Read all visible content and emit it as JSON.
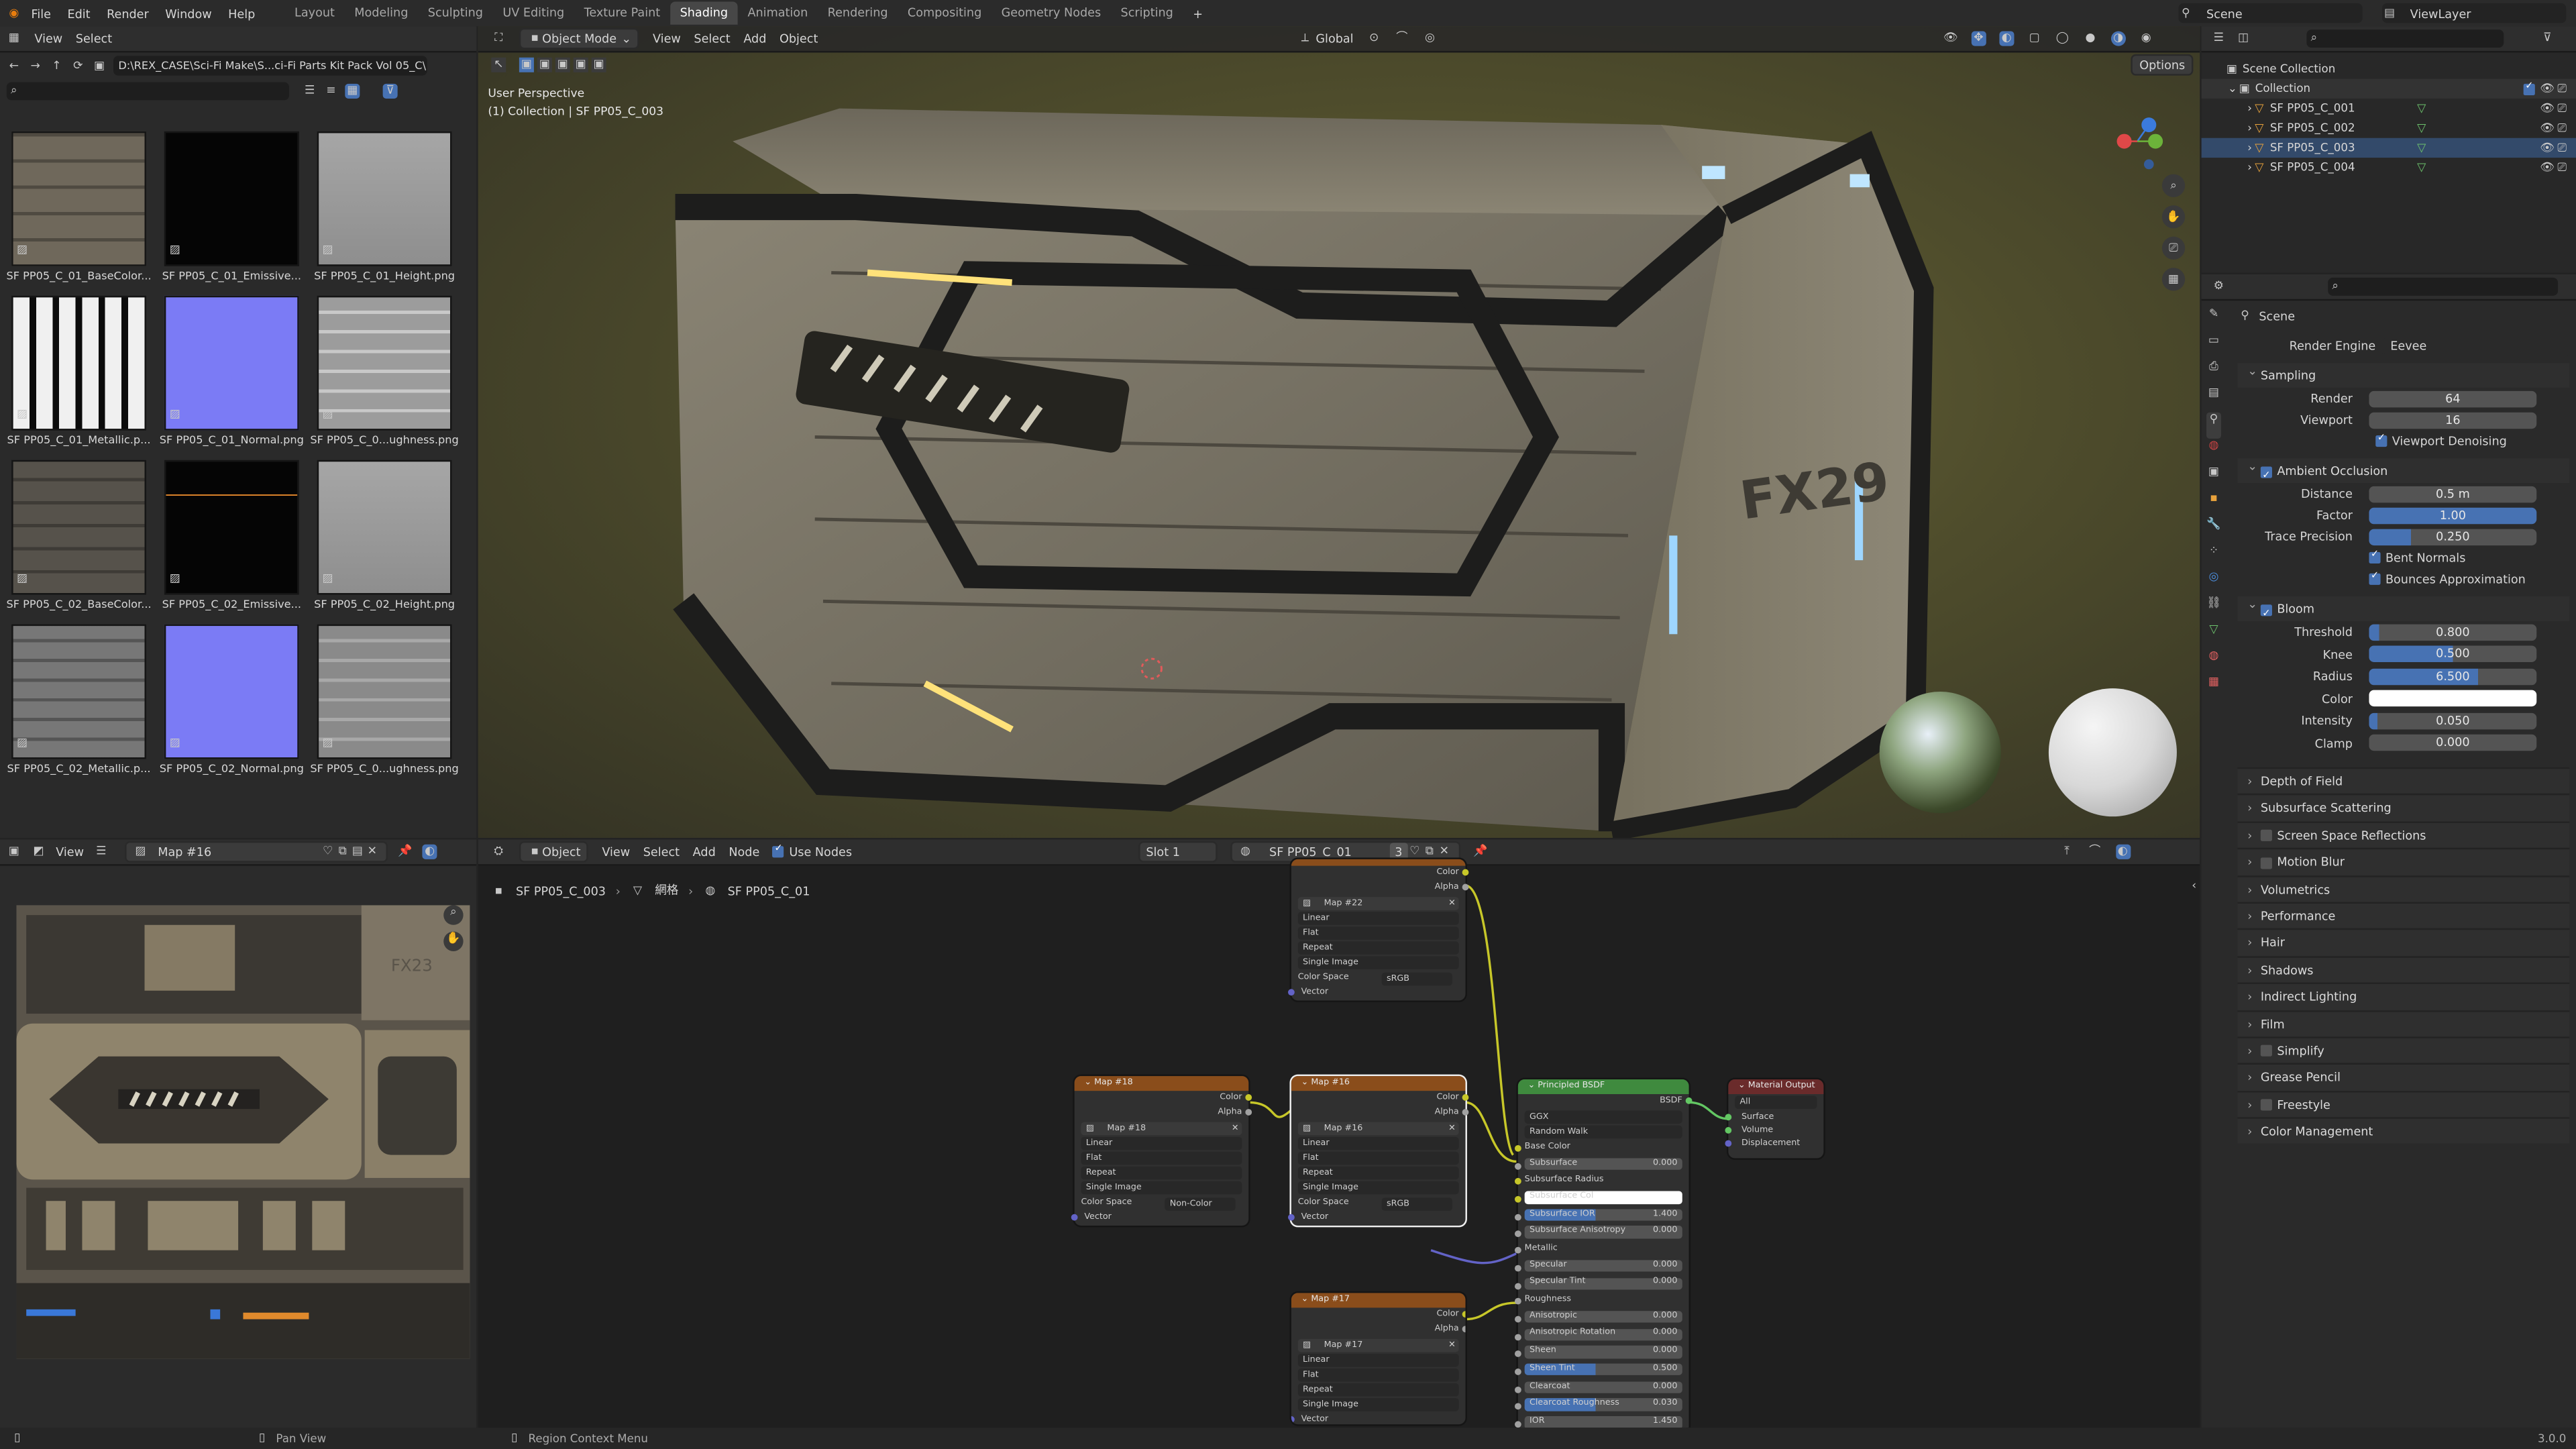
{
  "topbar": {
    "menus": [
      "File",
      "Edit",
      "Render",
      "Window",
      "Help"
    ],
    "workspaces": [
      "Layout",
      "Modeling",
      "Sculpting",
      "UV Editing",
      "Texture Paint",
      "Shading",
      "Animation",
      "Rendering",
      "Compositing",
      "Geometry Nodes",
      "Scripting"
    ],
    "active_workspace": "Shading",
    "scene": "Scene",
    "view_layer": "ViewLayer"
  },
  "file_browser": {
    "menus": [
      "View",
      "Select"
    ],
    "path": "D:\\REX_CASE\\Sci-Fi Make\\S...ci-Fi Parts Kit Pack Vol 05_C\\",
    "thumbnails": [
      {
        "label": "SF PP05_C_01_BaseColor...",
        "kind": "basecolor"
      },
      {
        "label": "SF PP05_C_01_Emissive...",
        "kind": "emissive"
      },
      {
        "label": "SF PP05_C_01_Height.png",
        "kind": "height"
      },
      {
        "label": "SF PP05_C_01_Metallic.p...",
        "kind": "metallic"
      },
      {
        "label": "SF PP05_C_01_Normal.png",
        "kind": "normal"
      },
      {
        "label": "SF PP05_C_0...ughness.png",
        "kind": "roughness"
      },
      {
        "label": "SF PP05_C_02_BaseColor...",
        "kind": "basecolor2"
      },
      {
        "label": "SF PP05_C_02_Emissive...",
        "kind": "emissive2"
      },
      {
        "label": "SF PP05_C_02_Height.png",
        "kind": "height"
      },
      {
        "label": "SF PP05_C_02_Metallic.p...",
        "kind": "metallic2"
      },
      {
        "label": "SF PP05_C_02_Normal.png",
        "kind": "normal"
      },
      {
        "label": "SF PP05_C_0...ughness.png",
        "kind": "roughness2"
      }
    ]
  },
  "viewport": {
    "mode": "Object Mode",
    "menus": [
      "View",
      "Select",
      "Add",
      "Object"
    ],
    "orientation": "Global",
    "options_label": "Options",
    "overlay_line1": "User Perspective",
    "overlay_line2": "(1) Collection | SF PP05_C_003",
    "model_text": "FX29"
  },
  "image_editor": {
    "view_label": "View",
    "image_name": "Map #16",
    "texture_text": "FX23"
  },
  "node_editor": {
    "object_label": "Object",
    "menus": [
      "View",
      "Select",
      "Add",
      "Node"
    ],
    "use_nodes": "Use Nodes",
    "slot": "Slot 1",
    "material": "SF PP05_C_01",
    "users": "3",
    "breadcrumb": [
      "SF PP05_C_003",
      "網格",
      "SF PP05_C_01"
    ],
    "image_nodes": [
      {
        "title": "Map #22",
        "image": "Map #22",
        "colorspace": "sRGB"
      },
      {
        "title": "Map #18",
        "image": "Map #18",
        "colorspace": "Non-Color"
      },
      {
        "title": "Map #16",
        "image": "Map #16",
        "colorspace": "sRGB"
      },
      {
        "title": "Map #17",
        "image": "Map #17",
        "colorspace": ""
      }
    ],
    "image_node_fields": {
      "interp": "Linear",
      "proj": "Flat",
      "ext": "Repeat",
      "source": "Single Image",
      "colorspace_label": "Color Space",
      "out_color": "Color",
      "out_alpha": "Alpha",
      "in_vector": "Vector"
    },
    "bsdf": {
      "title": "Principled BSDF",
      "out": "BSDF",
      "dist": "GGX",
      "sss": "Random Walk",
      "rows": [
        {
          "label": "Base Color",
          "value": ""
        },
        {
          "label": "Subsurface",
          "value": "0.000"
        },
        {
          "label": "Subsurface Radius",
          "value": ""
        },
        {
          "label": "Subsurface Col",
          "value": ""
        },
        {
          "label": "Subsurface IOR",
          "value": "1.400"
        },
        {
          "label": "Subsurface Anisotropy",
          "value": "0.000"
        },
        {
          "label": "Metallic",
          "value": ""
        },
        {
          "label": "Specular",
          "value": "0.000"
        },
        {
          "label": "Specular Tint",
          "value": "0.000"
        },
        {
          "label": "Roughness",
          "value": ""
        },
        {
          "label": "Anisotropic",
          "value": "0.000"
        },
        {
          "label": "Anisotropic Rotation",
          "value": "0.000"
        },
        {
          "label": "Sheen",
          "value": "0.000"
        },
        {
          "label": "Sheen Tint",
          "value": "0.500"
        },
        {
          "label": "Clearcoat",
          "value": "0.000"
        },
        {
          "label": "Clearcoat Roughness",
          "value": "0.030"
        },
        {
          "label": "IOR",
          "value": "1.450"
        }
      ]
    },
    "output": {
      "title": "Material Output",
      "target": "All",
      "inputs": [
        "Surface",
        "Volume",
        "Displacement"
      ]
    }
  },
  "outliner": {
    "root": "Scene Collection",
    "collection": "Collection",
    "objects": [
      "SF PP05_C_001",
      "SF PP05_C_002",
      "SF PP05_C_003",
      "SF PP05_C_004"
    ]
  },
  "properties": {
    "context": "Scene",
    "render_engine_label": "Render Engine",
    "render_engine": "Eevee",
    "sampling": {
      "title": "Sampling",
      "render_label": "Render",
      "render": "64",
      "viewport_label": "Viewport",
      "viewport": "16",
      "denoise": "Viewport Denoising"
    },
    "ao": {
      "title": "Ambient Occlusion",
      "distance_label": "Distance",
      "distance": "0.5 m",
      "factor_label": "Factor",
      "factor": "1.00",
      "trace_label": "Trace Precision",
      "trace": "0.250",
      "bent": "Bent Normals",
      "bounces": "Bounces Approximation"
    },
    "bloom": {
      "title": "Bloom",
      "threshold_label": "Threshold",
      "threshold": "0.800",
      "knee_label": "Knee",
      "knee": "0.500",
      "radius_label": "Radius",
      "radius": "6.500",
      "color_label": "Color",
      "intensity_label": "Intensity",
      "intensity": "0.050",
      "clamp_label": "Clamp",
      "clamp": "0.000"
    },
    "collapsed": [
      "Depth of Field",
      "Subsurface Scattering",
      "Screen Space Reflections",
      "Motion Blur",
      "Volumetrics",
      "Performance",
      "Hair",
      "Shadows",
      "Indirect Lighting",
      "Film",
      "Simplify",
      "Grease Pencil",
      "Freestyle",
      "Color Management"
    ]
  },
  "statusbar": {
    "left": "Pan View",
    "middle": "Region Context Menu",
    "version": "3.0.0"
  },
  "colors": {
    "accent": "#4772b3",
    "image_node": "#8a4d1b",
    "shader_node": "#3f8a3e",
    "output_node": "#6a2b2b"
  }
}
